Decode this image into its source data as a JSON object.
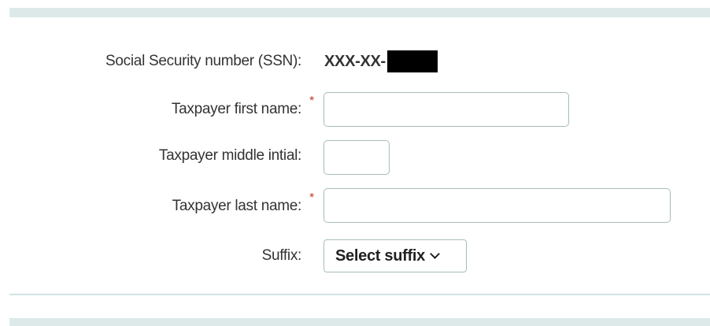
{
  "form": {
    "ssn": {
      "label": "Social Security number (SSN):",
      "value_prefix": "XXX-XX-"
    },
    "first_name": {
      "label": "Taxpayer first name:",
      "required_marker": "*",
      "value": ""
    },
    "middle_initial": {
      "label": "Taxpayer middle intial:",
      "value": ""
    },
    "last_name": {
      "label": "Taxpayer last name:",
      "required_marker": "*",
      "value": ""
    },
    "suffix": {
      "label": "Suffix:",
      "selected": "Select suffix"
    }
  },
  "colors": {
    "band": "#dde9e9",
    "required": "#c0392b",
    "input_border": "#a8bcbc",
    "text": "#333333"
  }
}
